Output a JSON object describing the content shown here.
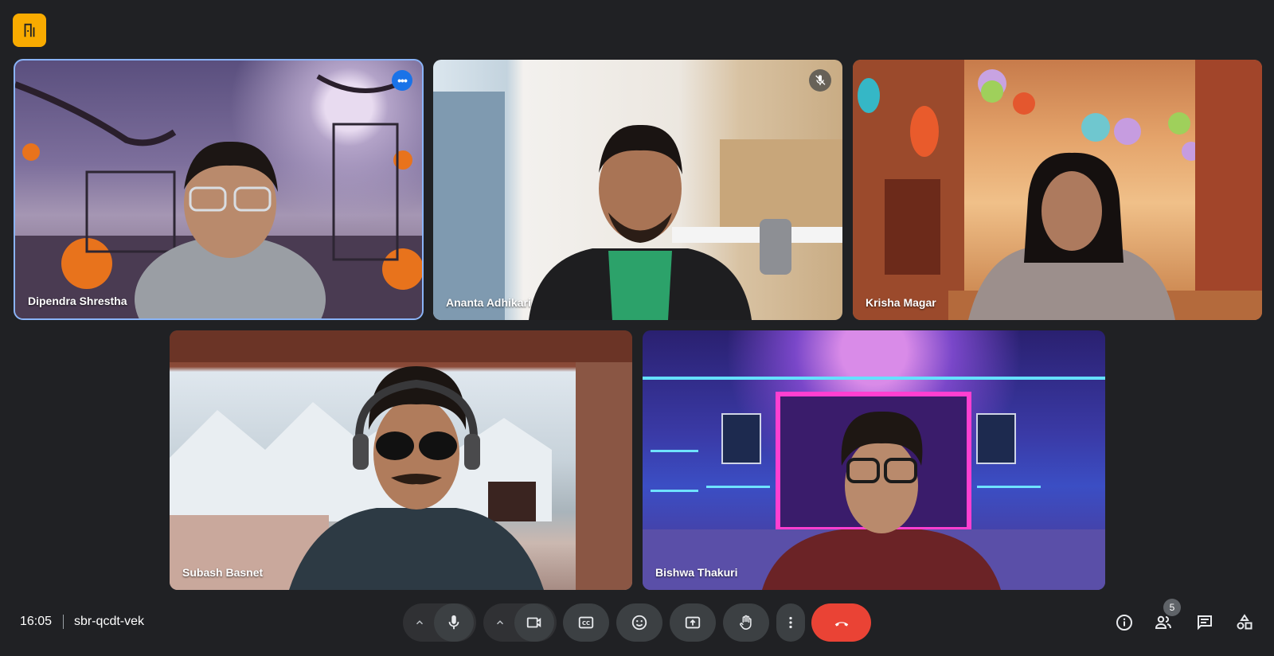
{
  "header": {
    "logo_icon": "door-exit-icon"
  },
  "participants": [
    {
      "name": "Dipendra Shrestha",
      "background": "halloween-scene",
      "active": true,
      "menu_icon": "more-options-icon"
    },
    {
      "name": "Ananta Adhikari",
      "background": "office-scene",
      "muted": true,
      "status_icon": "mic-off-icon"
    },
    {
      "name": "Krisha Magar",
      "background": "chinatown-lanterns-scene"
    },
    {
      "name": "Subash Basnet",
      "background": "snowy-cabin-scene"
    },
    {
      "name": "Bishwa Thakuri",
      "background": "neon-gaming-room-scene"
    }
  ],
  "meeting": {
    "time": "16:05",
    "code": "sbr-qcdt-vek"
  },
  "controls": {
    "mic_icon": "mic-icon",
    "camera_icon": "videocam-icon",
    "captions_icon": "closed-captions-icon",
    "reactions_icon": "emoji-icon",
    "present_icon": "present-screen-icon",
    "raise_hand_icon": "raise-hand-icon",
    "more_icon": "more-vert-icon",
    "hangup_icon": "call-end-icon"
  },
  "side_controls": {
    "info_icon": "info-icon",
    "people_icon": "people-icon",
    "people_count": "5",
    "chat_icon": "chat-icon",
    "activities_icon": "activities-icon"
  },
  "colors": {
    "background": "#202124",
    "hangup": "#ea4335",
    "active_border": "#8ab4f8",
    "logo": "#f9ab00"
  }
}
